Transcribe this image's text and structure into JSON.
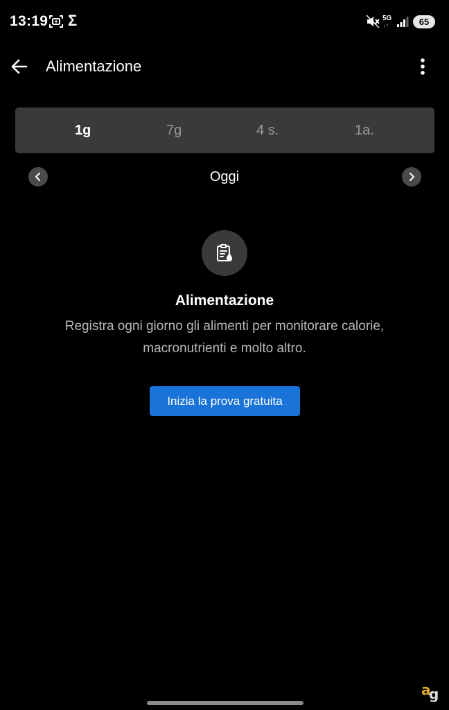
{
  "status_bar": {
    "time": "13:19",
    "network": "5G",
    "network_arrows": "↓↑",
    "battery": "65",
    "icons": [
      "screenshot-icon",
      "sigma-icon",
      "mute-icon",
      "signal-icon"
    ]
  },
  "app_bar": {
    "title": "Alimentazione",
    "back_icon": "arrow-left-icon",
    "menu_icon": "more-vert-icon"
  },
  "tabs": [
    {
      "label": "1g",
      "active": true
    },
    {
      "label": "7g",
      "active": false
    },
    {
      "label": "4 s.",
      "active": false
    },
    {
      "label": "1a.",
      "active": false
    }
  ],
  "date_nav": {
    "label": "Oggi",
    "prev_icon": "chevron-left-icon",
    "next_icon": "chevron-right-icon"
  },
  "empty_state": {
    "icon": "food-log-icon",
    "title": "Alimentazione",
    "description": "Registra ogni giorno gli alimenti per monitorare calorie, macronutrienti e molto altro.",
    "button_label": "Inizia la prova gratuita"
  },
  "colors": {
    "background": "#000000",
    "accent_button": "#1a73d8",
    "tab_bar": "#3a3a3a"
  }
}
